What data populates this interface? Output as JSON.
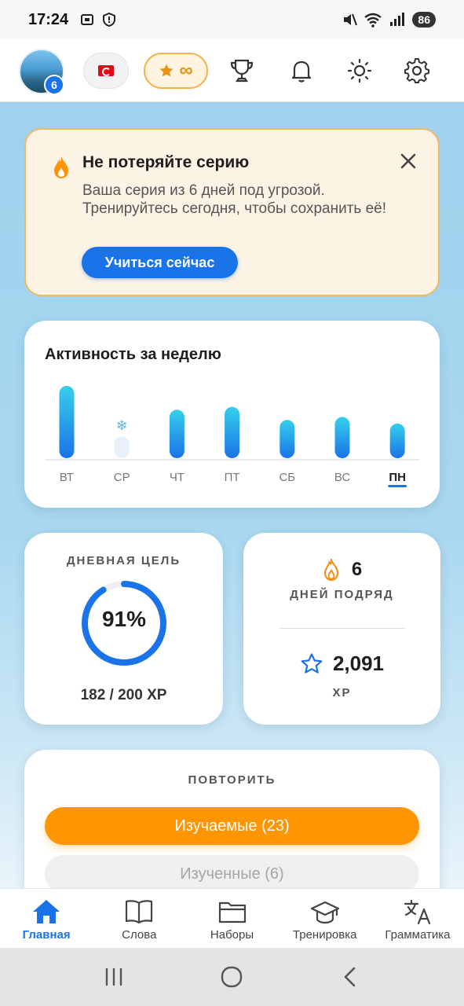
{
  "status_bar": {
    "time": "17:24",
    "battery": "86"
  },
  "top_bar": {
    "avatar_level": "6",
    "stars_value": "∞"
  },
  "streak_alert": {
    "title": "Не потеряйте серию",
    "body": "Ваша серия из 6 дней под угрозой. Тренируйтесь сегодня, чтобы сохранить её!",
    "button": "Учиться сейчас"
  },
  "activity": {
    "title": "Активность за неделю",
    "days": [
      "ВТ",
      "СР",
      "ЧТ",
      "ПТ",
      "СБ",
      "ВС",
      "ПН"
    ],
    "relative_activity": [
      1.0,
      0.3,
      0.67,
      0.71,
      0.53,
      0.57,
      0.48
    ],
    "freeze_day": "СР",
    "current_day": "ПН"
  },
  "daily_goal": {
    "label": "ДНЕВНАЯ ЦЕЛЬ",
    "percent": "91%",
    "progress": 0.91,
    "xp": "182 / 200 XP"
  },
  "streak": {
    "days": "6",
    "days_label": "ДНЕЙ ПОДРЯД",
    "xp_total": "2,091",
    "xp_label": "XP"
  },
  "review": {
    "label": "ПОВТОРИТЬ",
    "learning_button": "Изучаемые (23)",
    "learned_button": "Изученные (6)"
  },
  "bottom_nav": {
    "home": "Главная",
    "words": "Слова",
    "sets": "Наборы",
    "training": "Тренировка",
    "grammar": "Грамматика"
  },
  "colors": {
    "accent": "#1a73e8",
    "orange": "#ff9500",
    "alert_bg": "#fdf3e4"
  }
}
